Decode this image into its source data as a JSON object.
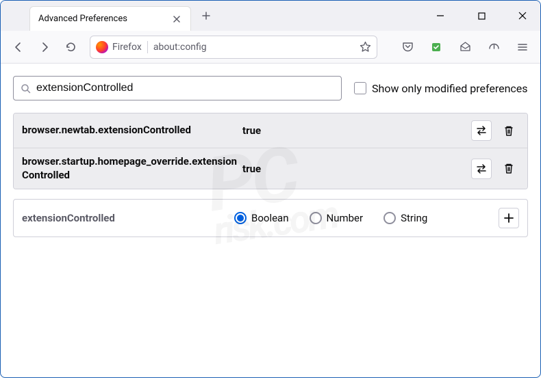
{
  "window": {
    "tab_title": "Advanced Preferences"
  },
  "toolbar": {
    "identity_label": "Firefox",
    "url": "about:config"
  },
  "search": {
    "value": "extensionControlled",
    "show_modified_label": "Show only modified preferences"
  },
  "prefs": [
    {
      "name": "browser.newtab.extensionControlled",
      "value": "true"
    },
    {
      "name": "browser.startup.homepage_override.extensionControlled",
      "value": "true"
    }
  ],
  "newpref": {
    "name": "extensionControlled",
    "types": [
      "Boolean",
      "Number",
      "String"
    ],
    "selected": "Boolean"
  },
  "watermark": {
    "main": "PC",
    "sub": "risk.com"
  }
}
